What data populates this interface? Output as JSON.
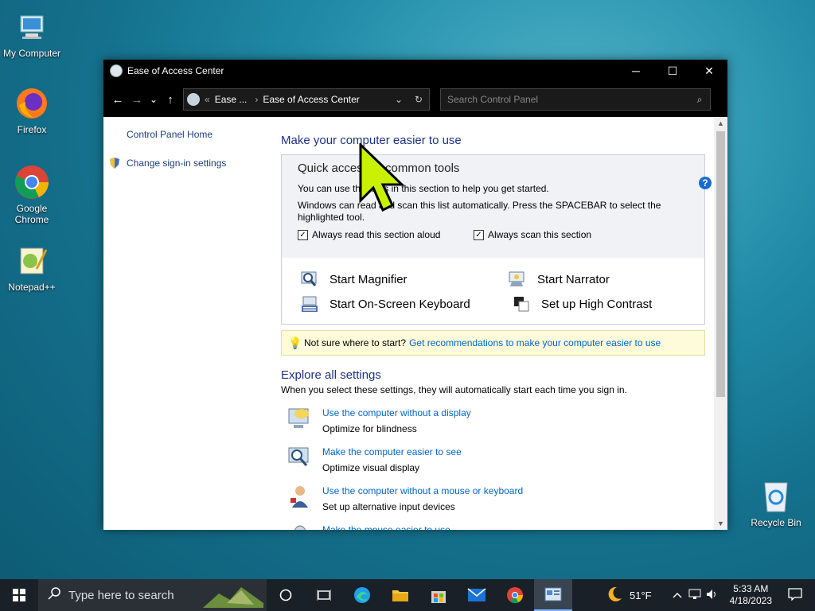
{
  "desktop": {
    "icons": [
      {
        "label": "My Computer"
      },
      {
        "label": "Firefox"
      },
      {
        "label": "Google Chrome"
      },
      {
        "label": "Notepad++"
      },
      {
        "label": "Recycle Bin"
      }
    ]
  },
  "window": {
    "title": "Ease of Access Center",
    "controls": {
      "minimize": "─",
      "maximize": "☐",
      "close": "✕"
    },
    "nav": {
      "back": "←",
      "forward": "→",
      "recent": "⌄",
      "up": "↑"
    },
    "address": {
      "prefix": "«",
      "crumb1": "Ease ...",
      "separator": "›",
      "crumb2": "Ease of Access Center",
      "dropdown": "⌄",
      "refresh": "↻"
    },
    "search": {
      "placeholder": "Search Control Panel",
      "icon": "⌕"
    },
    "help": "?"
  },
  "left_pane": {
    "home_link": "Control Panel Home",
    "signin_link": "Change sign-in settings"
  },
  "main": {
    "heading": "Make your computer easier to use",
    "quick": {
      "heading": "Quick access to common tools",
      "line1": "You can use the tools in this section to help you get started.",
      "line2a": "Windows can read and scan this list automatically.  Press the SPACEBAR to select the",
      "line2b": "highlighted tool.",
      "check_read": "Always read this section aloud",
      "check_scan": "Always scan this section"
    },
    "tools": {
      "magnifier": "Start Magnifier",
      "narrator": "Start Narrator",
      "keyboard": "Start On-Screen Keyboard",
      "contrast": "Set up High Contrast"
    },
    "tip": {
      "text": "Not sure where to start?",
      "link": "Get recommendations to make your computer easier to use"
    },
    "explore": {
      "heading": "Explore all settings",
      "desc": "When you select these settings, they will automatically start each time you sign in.",
      "items": [
        {
          "link": "Use the computer without a display",
          "desc": "Optimize for blindness"
        },
        {
          "link": "Make the computer easier to see",
          "desc": "Optimize visual display"
        },
        {
          "link": "Use the computer without a mouse or keyboard",
          "desc": "Set up alternative input devices"
        },
        {
          "link": "Make the mouse easier to use",
          "desc": ""
        }
      ]
    }
  },
  "taskbar": {
    "search_placeholder": "Type here to search",
    "weather": "51°F",
    "time": "5:33 AM",
    "date": "4/18/2023"
  }
}
